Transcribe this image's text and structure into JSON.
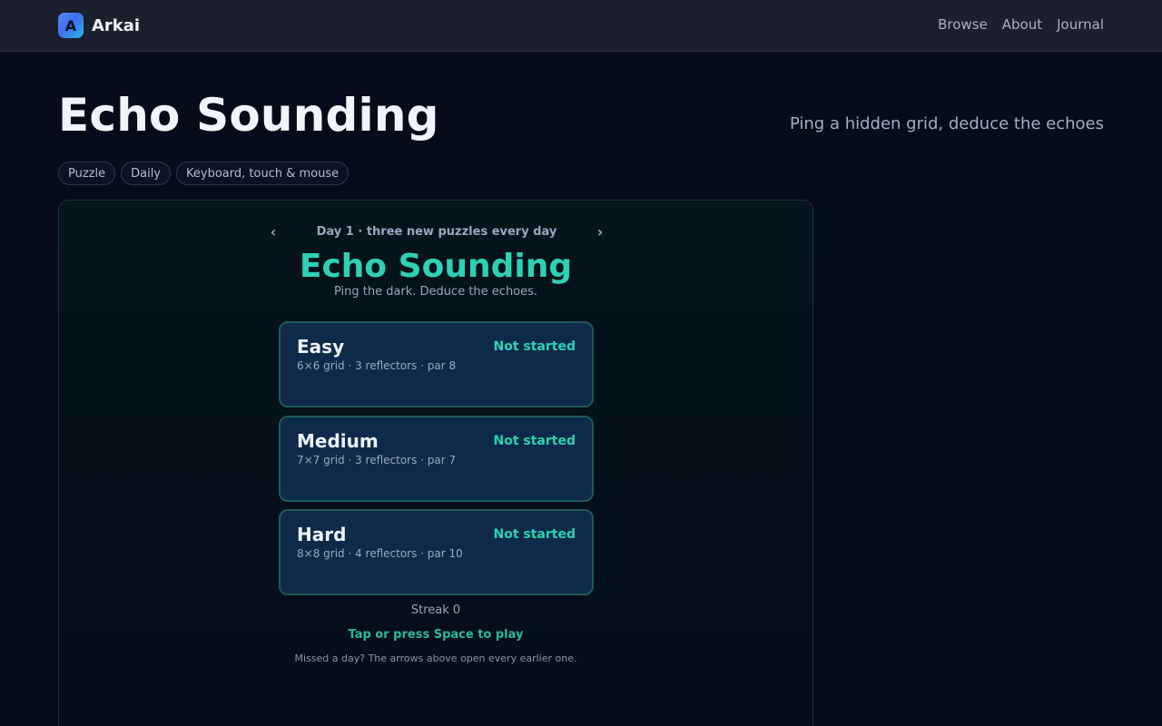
{
  "brand": {
    "logo_letter": "A",
    "name": "Arkai"
  },
  "nav": {
    "browse": "Browse",
    "about": "About",
    "journal": "Journal"
  },
  "page": {
    "title": "Echo Sounding",
    "tagline": "Ping a hidden grid, deduce the echoes",
    "tags": [
      "Puzzle",
      "Daily",
      "Keyboard, touch & mouse"
    ]
  },
  "game": {
    "prev_arrow": "‹",
    "next_arrow": "›",
    "day_label": "Day 1 · three new puzzles every day",
    "title": "Echo Sounding",
    "subtitle": "Ping the dark. Deduce the echoes.",
    "levels": [
      {
        "name": "Easy",
        "desc": "6×6 grid · 3 reflectors · par 8",
        "status": "Not started"
      },
      {
        "name": "Medium",
        "desc": "7×7 grid · 3 reflectors · par 7",
        "status": "Not started"
      },
      {
        "name": "Hard",
        "desc": "8×8 grid · 4 reflectors · par 10",
        "status": "Not started"
      }
    ],
    "streak": "Streak 0",
    "play_hint": "Tap or press Space to play",
    "footnote": "Missed a day? The arrows above open every earlier one."
  },
  "colors": {
    "accent": "#2ed1b4",
    "background": "#070c1a",
    "card": "#0e2a4a"
  }
}
